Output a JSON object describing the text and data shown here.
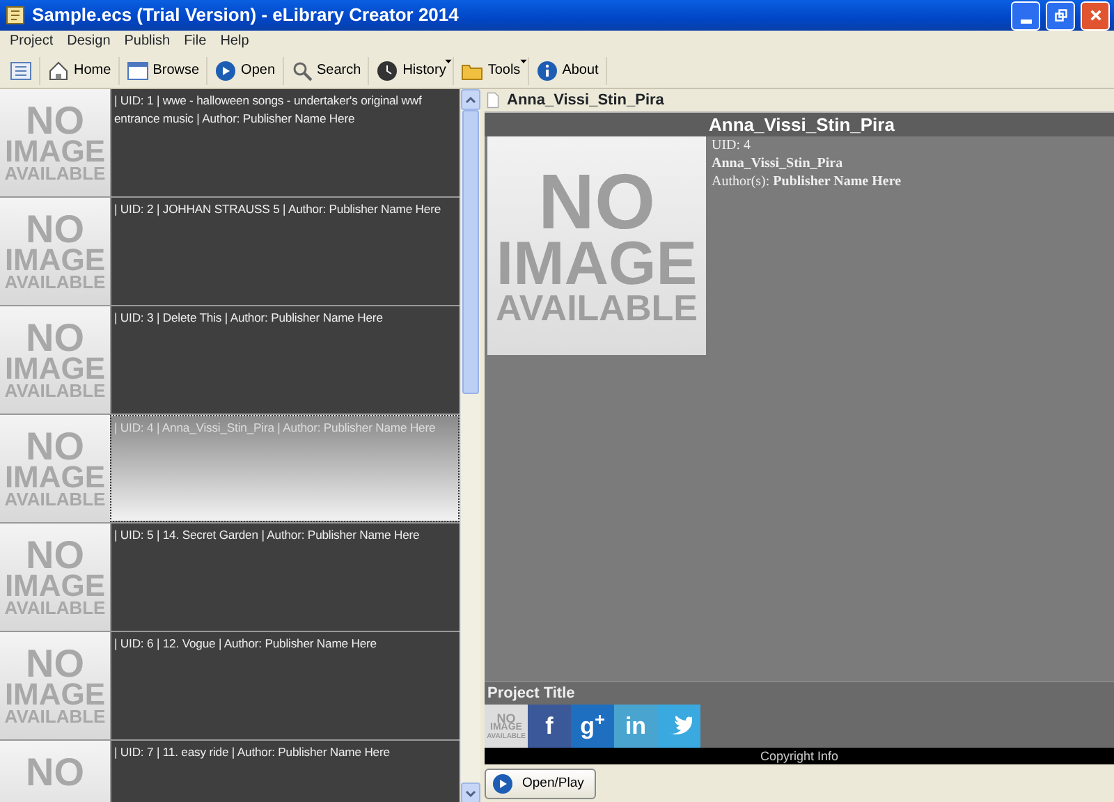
{
  "window": {
    "title": "Sample.ecs (Trial Version) - eLibrary Creator 2014"
  },
  "menu": [
    "Project",
    "Design",
    "Publish",
    "File",
    "Help"
  ],
  "toolbar": [
    {
      "kind": "list"
    },
    {
      "kind": "home",
      "label": "Home"
    },
    {
      "kind": "browse",
      "label": "Browse"
    },
    {
      "kind": "open",
      "label": "Open"
    },
    {
      "kind": "search",
      "label": "Search"
    },
    {
      "kind": "history",
      "label": "History",
      "dropdown": true
    },
    {
      "kind": "tools",
      "label": "Tools",
      "dropdown": true
    },
    {
      "kind": "about",
      "label": "About"
    }
  ],
  "books": [
    {
      "text": "| UID:  1 | wwe - halloween songs - undertaker's original wwf entrance music | Author: Publisher Name Here",
      "selected": false,
      "thumbnail": [
        "NO",
        "IMAGE",
        "AVAILABLE"
      ]
    },
    {
      "text": "| UID:  2 | JOHHAN STRAUSS 5 | Author: Publisher Name Here",
      "selected": false,
      "thumbnail": [
        "NO",
        "IMAGE",
        "AVAILABLE"
      ]
    },
    {
      "text": "| UID:  3 | Delete This | Author: Publisher Name Here",
      "selected": false,
      "thumbnail": [
        "NO",
        "IMAGE",
        "AVAILABLE"
      ]
    },
    {
      "text": "| UID:  4 | Anna_Vissi_Stin_Pira | Author: Publisher Name Here",
      "selected": true,
      "thumbnail": [
        "NO",
        "IMAGE",
        "AVAILABLE"
      ]
    },
    {
      "text": "| UID:  5 | 14. Secret Garden | Author: Publisher Name Here",
      "selected": false,
      "thumbnail": [
        "NO",
        "IMAGE",
        "AVAILABLE"
      ]
    },
    {
      "text": "| UID:  6 | 12. Vogue | Author: Publisher Name Here",
      "selected": false,
      "thumbnail": [
        "NO",
        "IMAGE",
        "AVAILABLE"
      ]
    },
    {
      "text": "| UID:  7 | 11. easy ride | Author: Publisher Name Here",
      "selected": false,
      "thumbnail": [
        "NO"
      ]
    }
  ],
  "preview": {
    "tab": "Anna_Vissi_Stin_Pira",
    "heading": "Anna_Vissi_Stin_Pira",
    "image": [
      "NO",
      "IMAGE",
      "AVAILABLE"
    ],
    "uid": "UID: 4",
    "name": "Anna_Vissi_Stin_Pira",
    "author_label": "Author(s):",
    "author": "Publisher Name Here",
    "project_title": "Project Title",
    "logo": [
      "NO",
      "IMAGE",
      "AVAILABLE"
    ],
    "social": [
      {
        "kind": "facebook",
        "label": "f",
        "color": "#3b5998"
      },
      {
        "kind": "google",
        "label": "g$^{+}$",
        "color": "#1f6fc1"
      },
      {
        "kind": "linkedin",
        "label": "in",
        "color": "#4aa4d0"
      },
      {
        "kind": "twitter",
        "color": "#3aa9e0"
      }
    ],
    "copyright": "Copyright Info"
  },
  "button": "Open/Play"
}
